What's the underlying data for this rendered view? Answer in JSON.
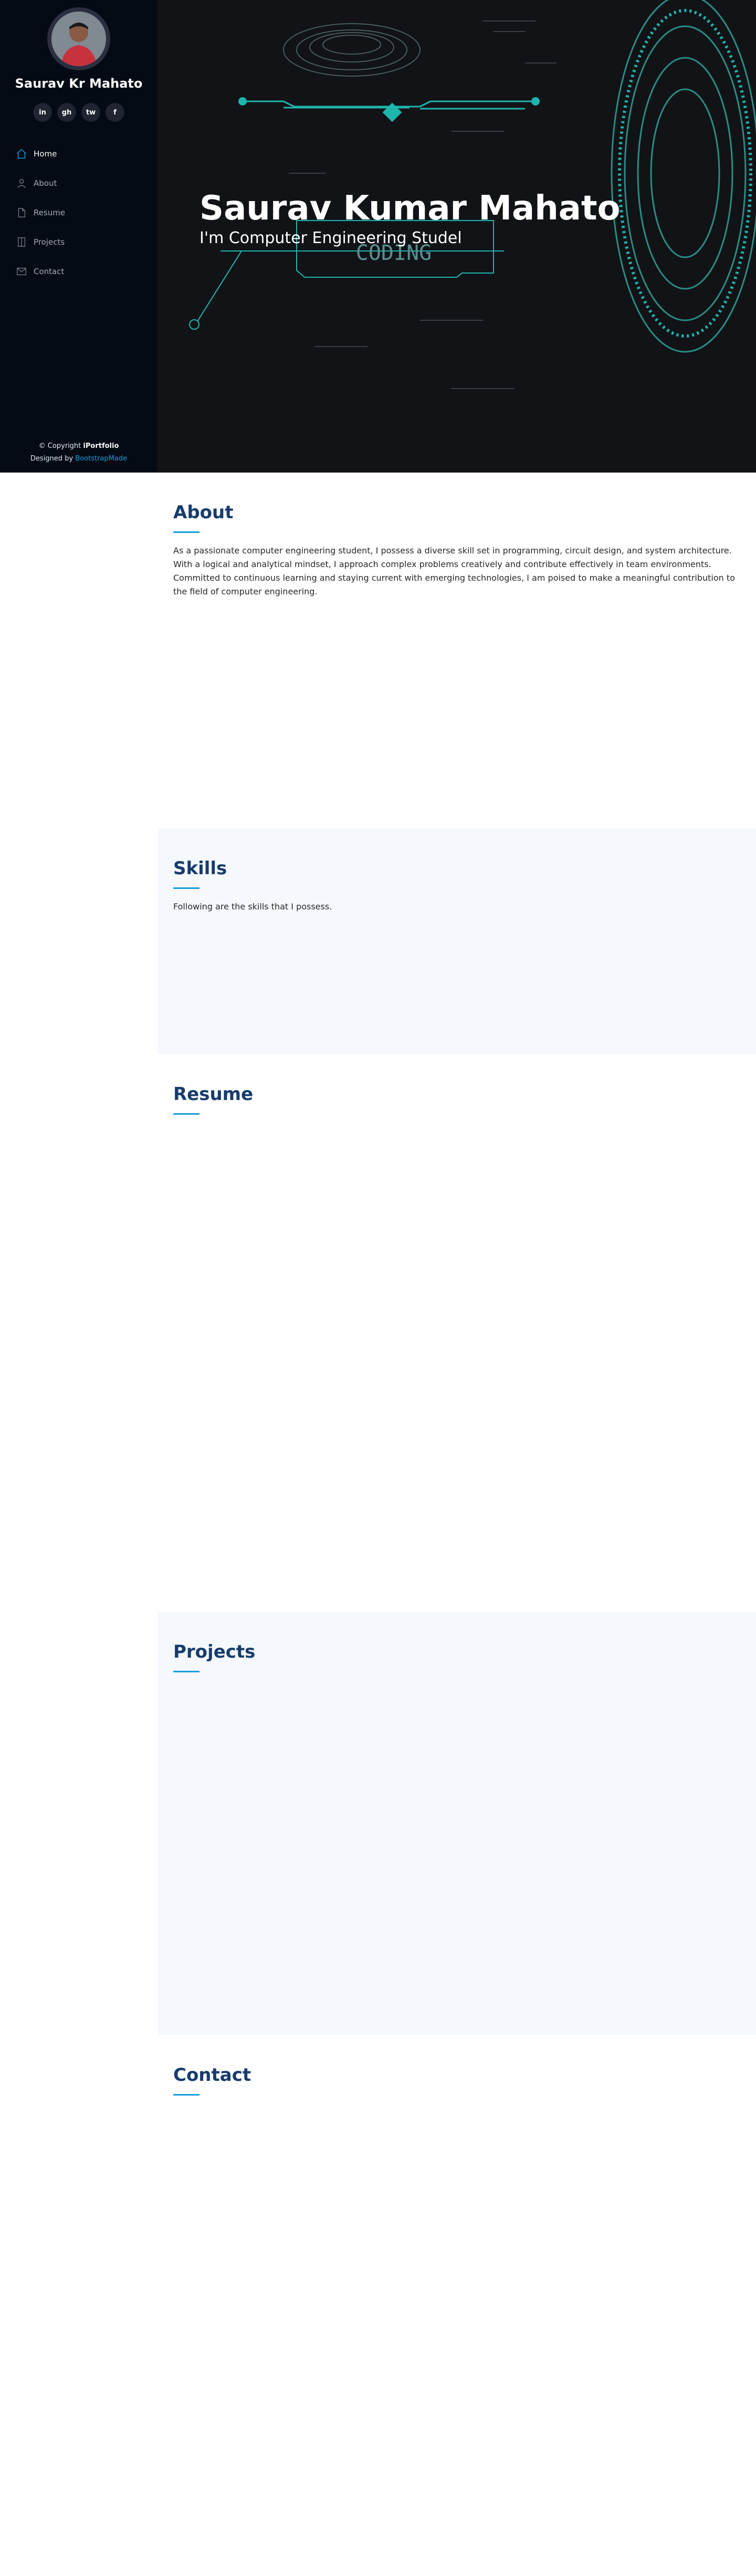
{
  "profile": {
    "name": "Saurav Kr Mahato"
  },
  "socials": [
    {
      "icon": "linkedin-icon",
      "label": "in"
    },
    {
      "icon": "github-icon",
      "label": "gh"
    },
    {
      "icon": "twitter-icon",
      "label": "tw"
    },
    {
      "icon": "facebook-icon",
      "label": "f"
    }
  ],
  "nav": [
    {
      "label": "Home",
      "icon": "home-icon"
    },
    {
      "label": "About",
      "icon": "person-icon"
    },
    {
      "label": "Resume",
      "icon": "file-icon"
    },
    {
      "label": "Projects",
      "icon": "book-icon"
    },
    {
      "label": "Contact",
      "icon": "envelope-icon"
    }
  ],
  "footer": {
    "copyright_prefix": "© Copyright",
    "brand": "iPortfolio",
    "designed_by": "Designed by",
    "designer": "BootstrapMade"
  },
  "hero": {
    "title": "Saurav Kumar Mahato",
    "subtitle": "I'm Computer Engineering Studel",
    "bg_word": "CODING"
  },
  "about": {
    "title": "About",
    "text": "As a passionate computer engineering student, I possess a diverse skill set in programming, circuit design, and system architecture. With a logical and analytical mindset, I approach complex problems creatively and contribute effectively in team environments. Committed to continuous learning and staying current with emerging technologies, I am poised to make a meaningful contribution to the field of computer engineering."
  },
  "skills": {
    "title": "Skills",
    "text": "Following are the skills that I possess."
  },
  "resume": {
    "title": "Resume"
  },
  "projects": {
    "title": "Projects"
  },
  "contact": {
    "title": "Contact"
  },
  "colors": {
    "accent": "#149ddd",
    "heading": "#173b6c",
    "sidebar": "#040b14",
    "hero_line": "#1fb5ad"
  }
}
